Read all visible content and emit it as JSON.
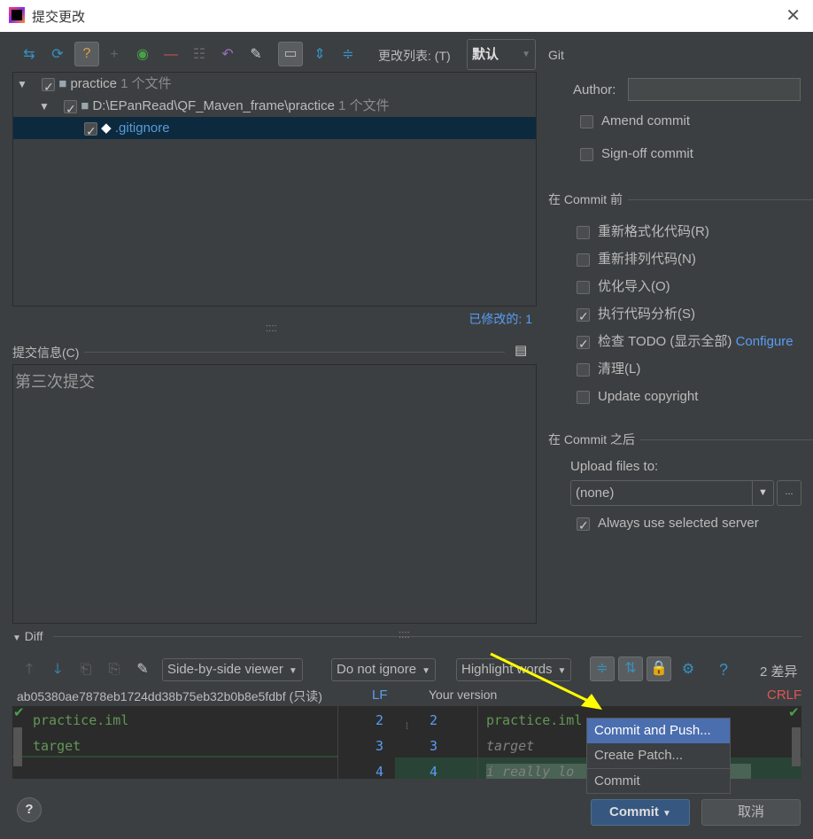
{
  "window": {
    "title": "提交更改"
  },
  "toolbar": {
    "changelist_label": "更改列表: (T)",
    "changelist_value": "默认"
  },
  "tree": [
    {
      "label": "practice",
      "count": "1 个文件"
    },
    {
      "label": "D:\\EPanRead\\QF_Maven_frame\\practice",
      "count": "1 个文件"
    },
    {
      "label": ".gitignore"
    }
  ],
  "modified": "已修改的: 1",
  "commit_message": {
    "label": "提交信息(C)",
    "value": "第三次提交"
  },
  "git": {
    "title": "Git",
    "author_label": "Author:",
    "author_value": "",
    "amend": "Amend commit",
    "signoff": "Sign-off commit",
    "before_title": "在 Commit 前",
    "before": [
      {
        "label": "重新格式化代码(R)",
        "checked": false
      },
      {
        "label": "重新排列代码(N)",
        "checked": false
      },
      {
        "label": "优化导入(O)",
        "checked": false
      },
      {
        "label": "执行代码分析(S)",
        "checked": true
      },
      {
        "label": "检查 TODO (显示全部)",
        "checked": true
      },
      {
        "label": "清理(L)",
        "checked": false
      },
      {
        "label": "Update copyright",
        "checked": false
      }
    ],
    "configure": "Configure",
    "after_title": "在 Commit 之后",
    "upload_label": "Upload files to:",
    "upload_value": "(none)",
    "more": "...",
    "always": "Always use selected server"
  },
  "diff": {
    "title": "Diff",
    "viewer": "Side-by-side viewer",
    "ignore": "Do not ignore",
    "highlight": "Highlight words",
    "count": "2 差异",
    "left_title": "ab05380ae7878eb1724dd38b75eb32b0b8e5fdbf (只读)",
    "left_eol": "LF",
    "right_title": "Your version",
    "right_eol": "CRLF",
    "left_lines": [
      "practice.iml",
      "target",
      ""
    ],
    "right_lines": [
      "practice.iml",
      "target",
      "i really lo"
    ],
    "left_nums": [
      "2",
      "3",
      "4"
    ],
    "right_nums": [
      "2",
      "3",
      "4"
    ]
  },
  "menu": [
    "Commit and Push...",
    "Create Patch...",
    "Commit"
  ],
  "buttons": {
    "commit": "Commit",
    "cancel": "取消",
    "help": "?"
  }
}
